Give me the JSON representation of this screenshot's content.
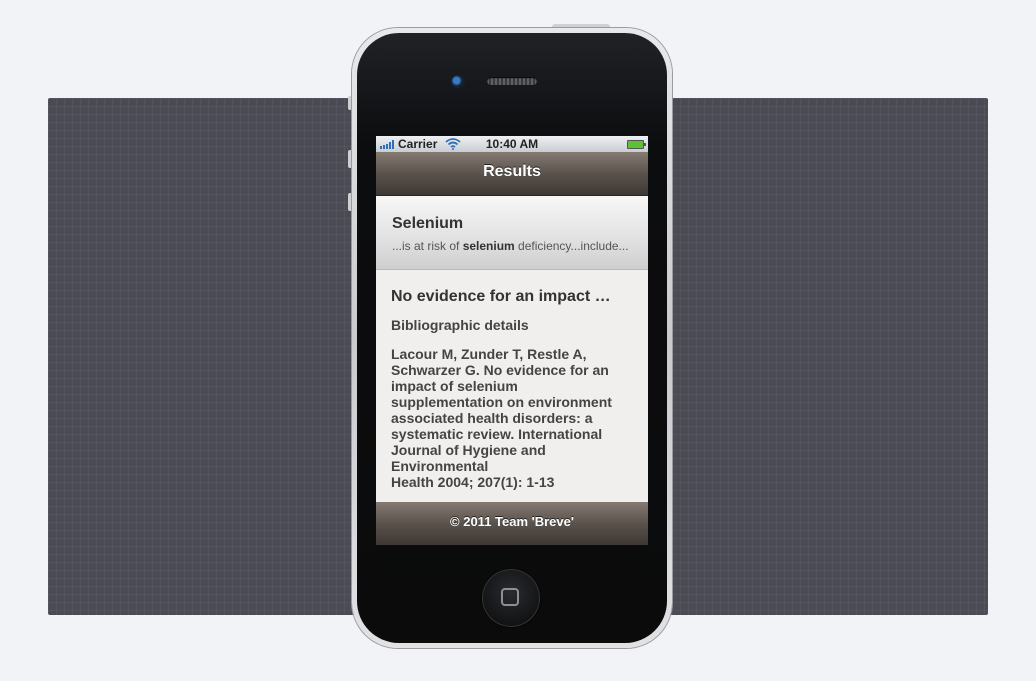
{
  "status_bar": {
    "carrier": "Carrier",
    "time": "10:40 AM",
    "signal_icon": "signal-bars-icon",
    "wifi_icon": "wifi-icon",
    "battery_icon": "battery-icon"
  },
  "header": {
    "title": "Results"
  },
  "result": {
    "title": "Selenium",
    "snippet_before": "...is at risk of ",
    "snippet_highlight": "selenium",
    "snippet_after": " deficiency...include..."
  },
  "detail": {
    "title": "No evidence for an impact of selenium supplementation on environment associated health disorders",
    "subtitle": "Bibliographic details",
    "citation_lines": [
      "Lacour M, Zunder T, Restle A,",
      "Schwarzer G.  No evidence for an",
      "impact of selenium",
      "supplementation on environment",
      "associated health disorders: a",
      "systematic review. International",
      "Journal of Hygiene and",
      "Environmental",
      "Health 2004; 207(1): 1-13"
    ]
  },
  "footer": {
    "text": "© 2011 Team 'Breve'"
  },
  "colors": {
    "bar_gradient_top": "#857b73",
    "bar_gradient_bottom": "#3e3834",
    "screen_background": "#f0efed",
    "backdrop": "#4b4b55"
  }
}
